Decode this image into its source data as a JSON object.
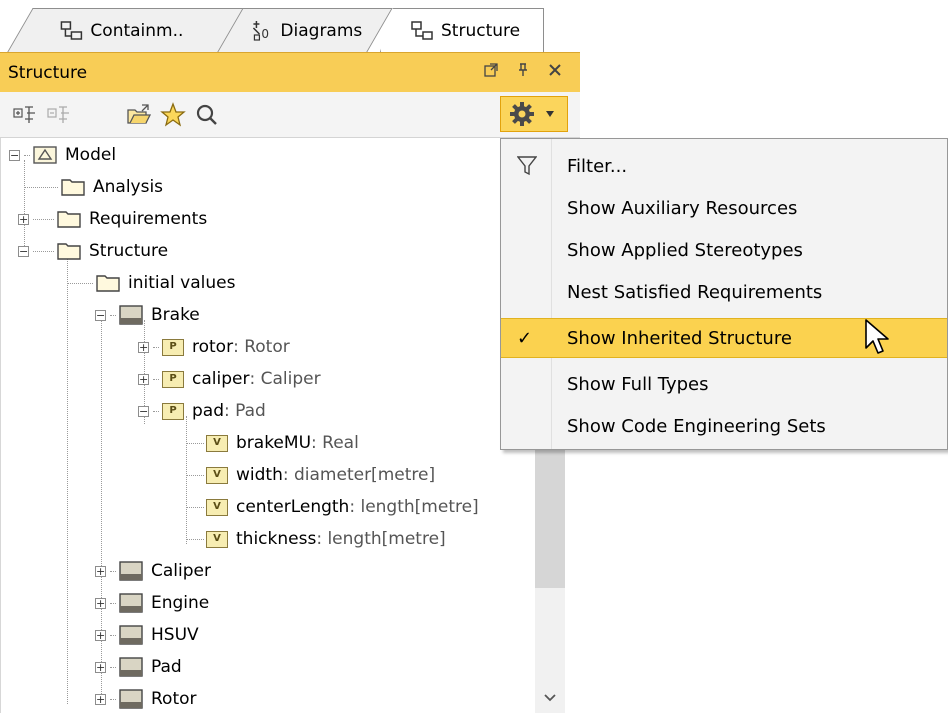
{
  "tabs": [
    {
      "label": "Containm..",
      "icon": "containment-icon"
    },
    {
      "label": "Diagrams",
      "icon": "diagrams-icon"
    },
    {
      "label": "Structure",
      "icon": "structure-icon",
      "active": true
    }
  ],
  "panel": {
    "title": "Structure"
  },
  "colors": {
    "accent": "#f8cd56",
    "selection": "#fbd24f",
    "menu_bg": "#f3f3f3"
  },
  "tree": [
    {
      "label": "Model",
      "type": "",
      "icon": "model-icon"
    },
    {
      "label": "Analysis",
      "type": "",
      "icon": "folder-icon"
    },
    {
      "label": "Requirements",
      "type": "",
      "icon": "folder-icon"
    },
    {
      "label": "Structure",
      "type": "",
      "icon": "folder-icon"
    },
    {
      "label": "initial values",
      "type": "",
      "icon": "folder-icon"
    },
    {
      "label": "Brake",
      "type": "",
      "icon": "block-icon"
    },
    {
      "label": "rotor",
      "type": " : Rotor",
      "icon": "part-icon"
    },
    {
      "label": "caliper",
      "type": " : Caliper",
      "icon": "part-icon"
    },
    {
      "label": "pad",
      "type": " : Pad",
      "icon": "part-icon"
    },
    {
      "label": "brakeMU",
      "type": " : Real",
      "icon": "value-icon"
    },
    {
      "label": "width",
      "type": " : diameter[metre]",
      "icon": "value-icon"
    },
    {
      "label": "centerLength",
      "type": " : length[metre]",
      "icon": "value-icon"
    },
    {
      "label": "thickness",
      "type": " : length[metre]",
      "icon": "value-icon"
    },
    {
      "label": "Caliper",
      "type": "",
      "icon": "block-icon"
    },
    {
      "label": "Engine",
      "type": "",
      "icon": "block-icon"
    },
    {
      "label": "HSUV",
      "type": "",
      "icon": "block-icon"
    },
    {
      "label": "Pad",
      "type": "",
      "icon": "block-icon"
    },
    {
      "label": "Rotor",
      "type": "",
      "icon": "block-icon"
    }
  ],
  "menu": [
    {
      "label": "Filter...",
      "icon": "filter-icon"
    },
    {
      "label": "Show Auxiliary Resources"
    },
    {
      "label": "Show Applied Stereotypes"
    },
    {
      "label": "Nest Satisfied Requirements"
    },
    {
      "label": "Show Inherited Structure",
      "checked": true,
      "highlighted": true
    },
    {
      "label": "Show Full Types"
    },
    {
      "label": "Show Code Engineering Sets"
    }
  ],
  "icons": {
    "part_letter": "P",
    "value_letter": "V",
    "check": "✓"
  }
}
